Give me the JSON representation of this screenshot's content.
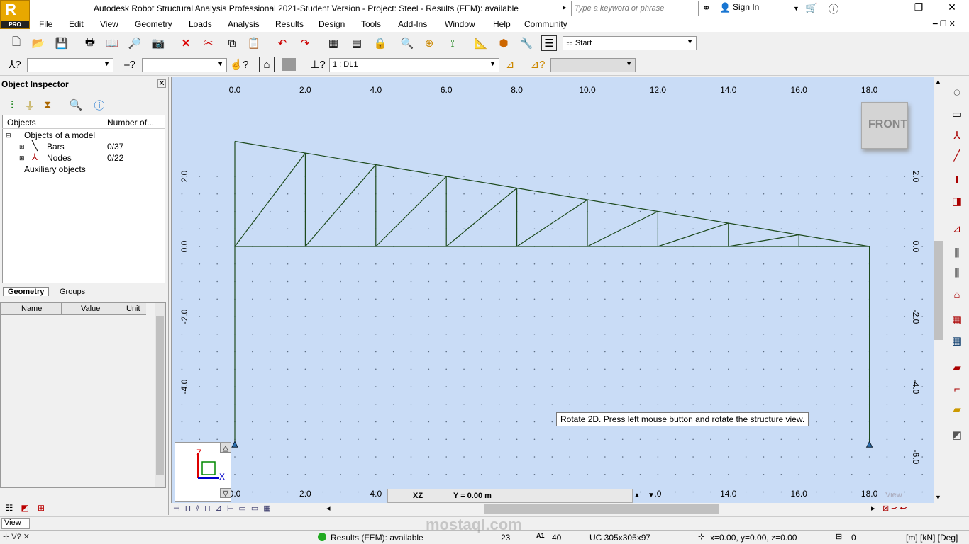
{
  "app": {
    "logo_letter": "R",
    "logo_badge": "PRO",
    "title": "Autodesk Robot Structural Analysis Professional 2021-Student Version - Project: Steel - Results (FEM): available",
    "search_placeholder": "Type a keyword or phrase",
    "sign_in": "Sign In"
  },
  "menu": [
    "File",
    "Edit",
    "View",
    "Geometry",
    "Loads",
    "Analysis",
    "Results",
    "Design",
    "Tools",
    "Add-Ins",
    "Window",
    "Help",
    "Community"
  ],
  "toolbar": {
    "layout_select": "Start",
    "load_case_select": "1 : DL1"
  },
  "inspector": {
    "title": "Object Inspector",
    "col_objects": "Objects",
    "col_number": "Number of...",
    "root": "Objects of a model",
    "bars_label": "Bars",
    "bars_count": "0/37",
    "nodes_label": "Nodes",
    "nodes_count": "0/22",
    "aux": "Auxiliary objects",
    "tab_geometry": "Geometry",
    "tab_groups": "Groups",
    "prop_name": "Name",
    "prop_value": "Value",
    "prop_unit": "Unit"
  },
  "canvas": {
    "top_ticks": [
      "0.0",
      "2.0",
      "4.0",
      "6.0",
      "8.0",
      "10.0",
      "12.0",
      "14.0",
      "16.0",
      "18.0"
    ],
    "bottom_ticks": [
      "0.0",
      "2.0",
      "4.0",
      ".0",
      "14.0",
      "16.0",
      "18.0"
    ],
    "left_ticks": [
      "2.0",
      "0.0",
      "-2.0",
      "-4.0",
      "-6.0"
    ],
    "right_ticks": [
      "2.0",
      "0.0",
      "-2.0",
      "-4.0",
      "-6.0"
    ],
    "front_label": "FRONT",
    "tooltip": "Rotate 2D. Press left mouse button and rotate the structure view.",
    "plane_label": "XZ",
    "plane_value": "Y = 0.00 m",
    "view_watermark": "View",
    "axis_z": "Z",
    "axis_x": "X"
  },
  "view_tab": "View",
  "status": {
    "results": "Results (FEM): available",
    "num1": "23",
    "num2": "40",
    "section": "UC 305x305x97",
    "coords": "x=0.00, y=0.00, z=0.00",
    "count": "0",
    "units": "[m] [kN] [Deg]"
  },
  "watermark": "mostaql.com"
}
